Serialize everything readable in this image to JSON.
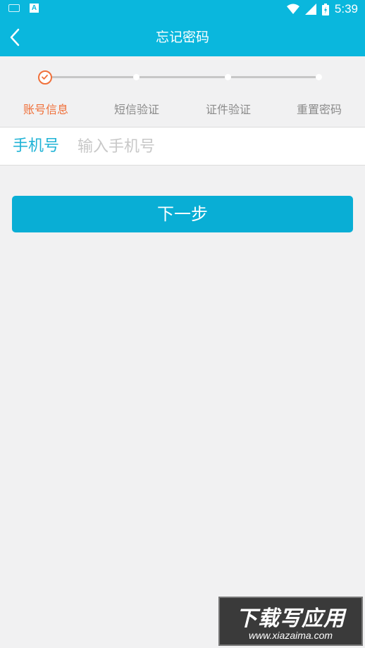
{
  "status_bar": {
    "time": "5:39",
    "left_icons": [
      "keyboard-icon",
      "a-badge-icon"
    ],
    "right_icons": [
      "wifi-icon",
      "signal-icon",
      "battery-icon"
    ]
  },
  "header": {
    "title": "忘记密码",
    "back_icon": "chevron-left-icon"
  },
  "stepper": {
    "current_step": 1,
    "steps": [
      {
        "label": "账号信息"
      },
      {
        "label": "短信验证"
      },
      {
        "label": "证件验证"
      },
      {
        "label": "重置密码"
      }
    ]
  },
  "form": {
    "phone_label": "手机号",
    "phone_value": "",
    "phone_placeholder": "输入手机号"
  },
  "next_button": {
    "label": "下一步"
  },
  "watermark": {
    "line1": "下载写应用",
    "line2": "www.xiazaima.com"
  },
  "colors": {
    "primary": "#0ab7dd",
    "button": "#09aed5",
    "active_step": "#f0703a",
    "background": "#f1f1f2"
  }
}
